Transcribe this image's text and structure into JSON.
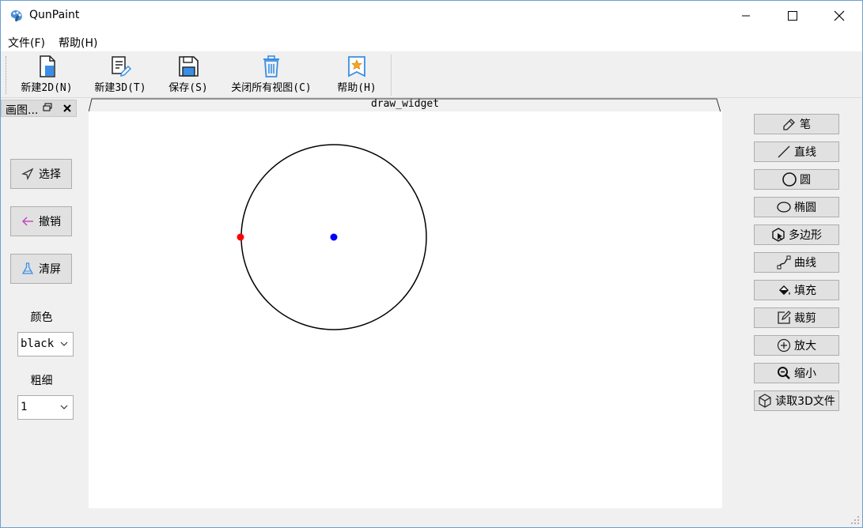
{
  "window": {
    "title": "QunPaint",
    "icon": "paint-palette-icon"
  },
  "menu": {
    "file": "文件(F)",
    "help": "帮助(H)"
  },
  "toolbar": {
    "items": [
      {
        "label": "新建2D(N)",
        "icon": "new-document-icon"
      },
      {
        "label": "新建3D(T)",
        "icon": "new-edit-document-icon"
      },
      {
        "label": "保存(S)",
        "icon": "save-disk-icon"
      },
      {
        "label": "关闭所有视图(C)",
        "icon": "trash-icon"
      },
      {
        "label": "帮助(H)",
        "icon": "help-star-icon"
      }
    ]
  },
  "dock": {
    "title": "画图...",
    "select_label": "选择",
    "undo_label": "撤销",
    "clear_label": "清屏",
    "color_label": "颜色",
    "color_value": "black",
    "thickness_label": "粗细",
    "thickness_value": "1"
  },
  "canvas": {
    "tab_title": "draw_widget",
    "shape": "circle",
    "stroke_color": "#000000",
    "center_point_color": "#0000ff",
    "edge_point_color": "#ff0000"
  },
  "tools": {
    "pen": "笔",
    "line": "直线",
    "circle": "圆",
    "ellipse": "椭圆",
    "polygon": "多边形",
    "curve": "曲线",
    "fill": "填充",
    "crop": "裁剪",
    "zoom_in": "放大",
    "zoom_out": "缩小",
    "read3d": "读取3D文件"
  }
}
